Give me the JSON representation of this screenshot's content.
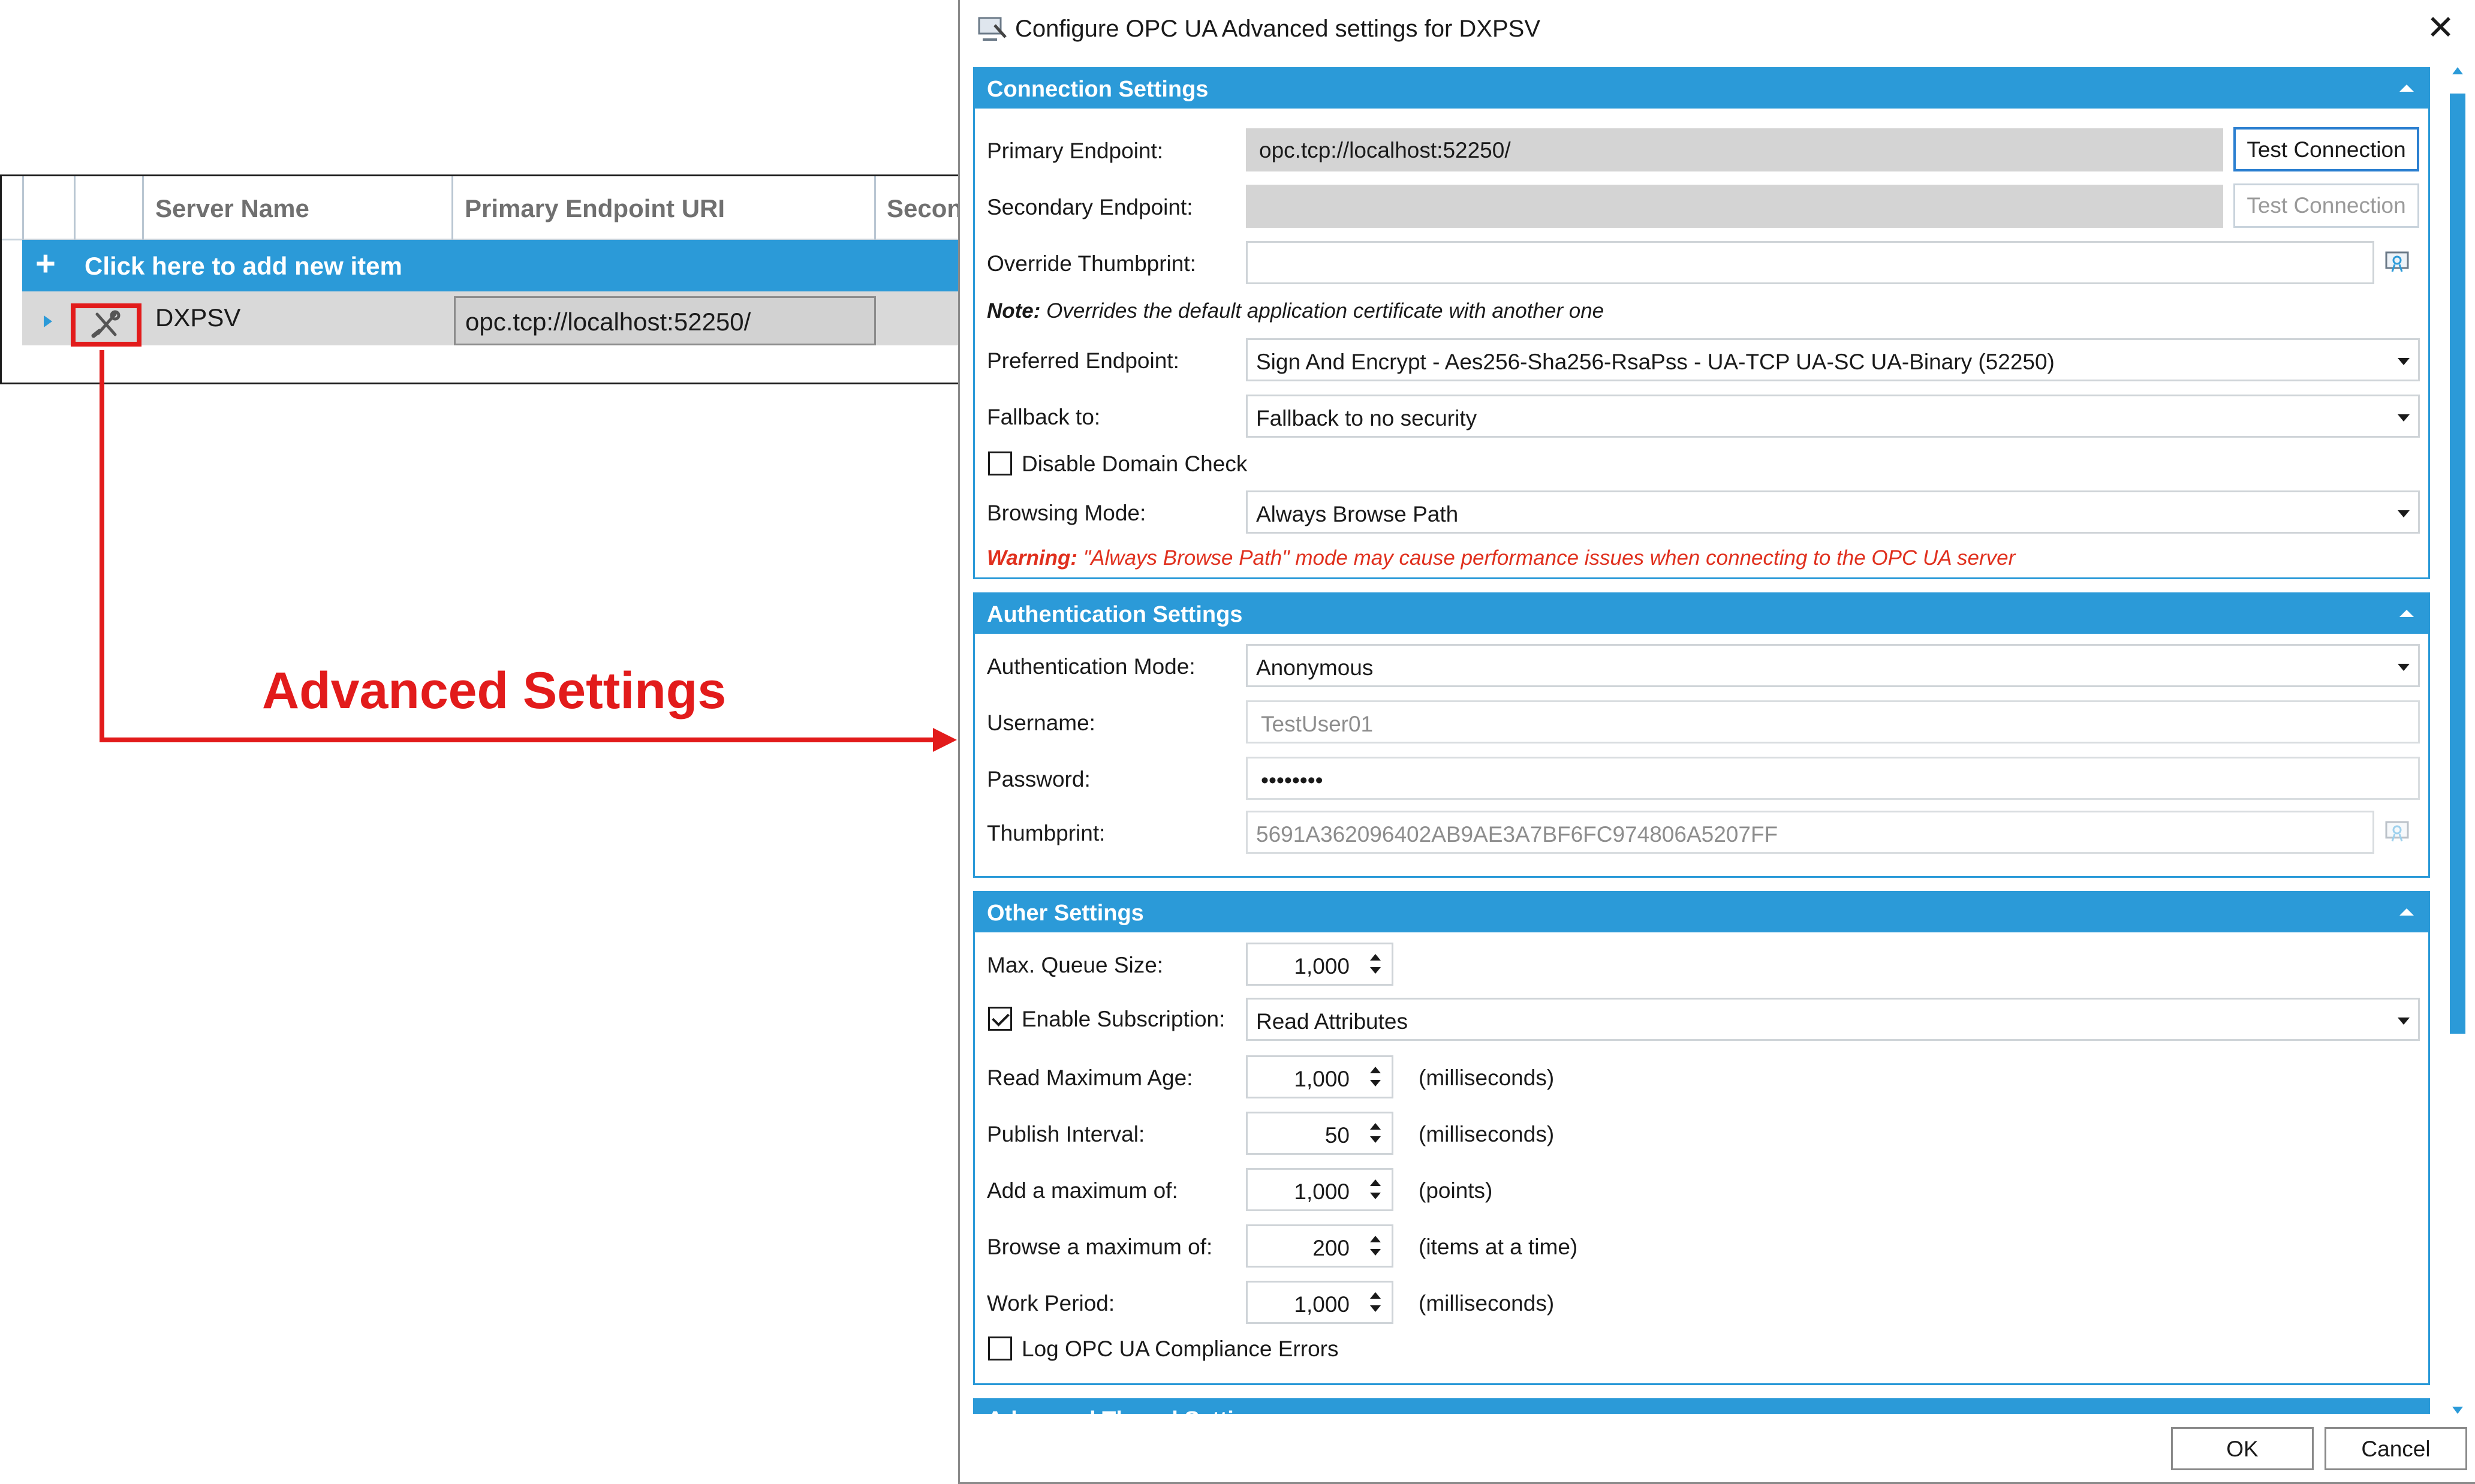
{
  "grid": {
    "columns": [
      "Server Name",
      "Primary Endpoint URI",
      "Secon"
    ],
    "add_row_label": "Click here to add new item",
    "add_icon": "+",
    "row": {
      "server_name": "DXPSV",
      "primary_uri": "opc.tcp://localhost:52250/"
    }
  },
  "annotation": {
    "label": "Advanced Settings",
    "color": "#e21b1b"
  },
  "dialog": {
    "title": "Configure OPC UA Advanced settings for DXPSV",
    "close": "✕",
    "accent": "#2b9ad8",
    "connection": {
      "header": "Connection Settings",
      "primary_label": "Primary Endpoint:",
      "primary_value": "opc.tcp://localhost:52250/",
      "test_primary": "Test Connection",
      "secondary_label": "Secondary Endpoint:",
      "secondary_value": "",
      "test_secondary": "Test Connection",
      "override_label": "Override Thumbprint:",
      "override_value": "",
      "note_bold": "Note:",
      "note_text": "Overrides the default application certificate with another one",
      "preferred_label": "Preferred Endpoint:",
      "preferred_value": "Sign And Encrypt - Aes256-Sha256-RsaPss - UA-TCP UA-SC UA-Binary (52250)",
      "fallback_label": "Fallback to:",
      "fallback_value": "Fallback to no security",
      "disable_domain_label": "Disable Domain Check",
      "browsing_label": "Browsing Mode:",
      "browsing_value": "Always Browse Path",
      "warning_bold": "Warning:",
      "warning_text": "\"Always Browse Path\" mode may cause performance issues when connecting to the OPC UA server",
      "warning_color": "#e0301e"
    },
    "auth": {
      "header": "Authentication Settings",
      "mode_label": "Authentication Mode:",
      "mode_value": "Anonymous",
      "username_label": "Username:",
      "username_value": "TestUser01",
      "password_label": "Password:",
      "password_value": "••••••••",
      "thumb_label": "Thumbprint:",
      "thumb_value": "5691A362096402AB9AE3A7BF6FC974806A5207FF"
    },
    "other": {
      "header": "Other Settings",
      "queue_label": "Max. Queue Size:",
      "queue_value": "1,000",
      "enable_sub_label": "Enable Subscription:",
      "enable_sub_value": "Read Attributes",
      "read_age_label": "Read Maximum Age:",
      "read_age_value": "1,000",
      "read_age_unit": "(milliseconds)",
      "publish_label": "Publish Interval:",
      "publish_value": "50",
      "publish_unit": "(milliseconds)",
      "add_max_label": "Add a maximum of:",
      "add_max_value": "1,000",
      "add_max_unit": "(points)",
      "browse_max_label": "Browse a maximum of:",
      "browse_max_value": "200",
      "browse_max_unit": "(items at a time)",
      "work_label": "Work Period:",
      "work_value": "1,000",
      "work_unit": "(milliseconds)",
      "log_label": "Log OPC UA Compliance Errors"
    },
    "next_header_partial": "Advanced Thread Settings",
    "ok": "OK",
    "cancel": "Cancel"
  }
}
